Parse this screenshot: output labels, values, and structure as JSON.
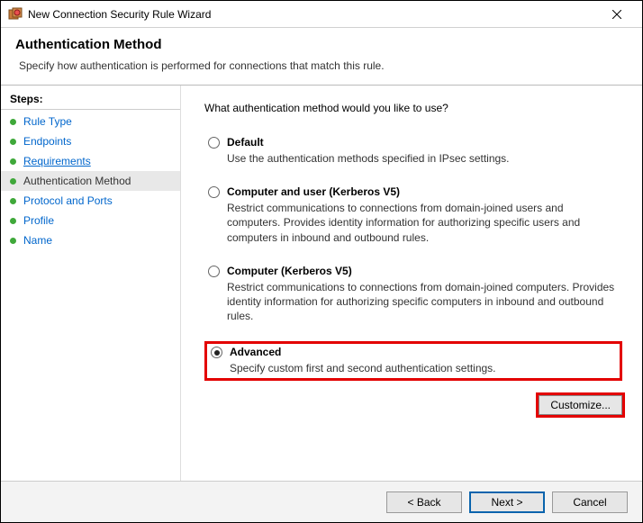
{
  "window": {
    "title": "New Connection Security Rule Wizard"
  },
  "header": {
    "title": "Authentication Method",
    "description": "Specify how authentication is performed for connections that match this rule."
  },
  "sidebar": {
    "steps_label": "Steps:",
    "items": [
      {
        "label": "Rule Type"
      },
      {
        "label": "Endpoints"
      },
      {
        "label": "Requirements"
      },
      {
        "label": "Authentication Method"
      },
      {
        "label": "Protocol and Ports"
      },
      {
        "label": "Profile"
      },
      {
        "label": "Name"
      }
    ]
  },
  "main": {
    "question": "What authentication method would you like to use?",
    "options": {
      "default": {
        "title": "Default",
        "desc": "Use the authentication methods specified in IPsec settings."
      },
      "computer_user": {
        "title": "Computer and user (Kerberos V5)",
        "desc": "Restrict communications to connections from domain-joined users and computers. Provides identity information for authorizing specific users and computers in inbound and outbound rules."
      },
      "computer": {
        "title": "Computer (Kerberos V5)",
        "desc": "Restrict communications to connections from domain-joined computers.  Provides identity information for authorizing specific computers in inbound and outbound rules."
      },
      "advanced": {
        "title": "Advanced",
        "desc": "Specify custom first and second authentication settings."
      }
    },
    "customize_label": "Customize..."
  },
  "footer": {
    "back": "< Back",
    "next": "Next >",
    "cancel": "Cancel"
  }
}
